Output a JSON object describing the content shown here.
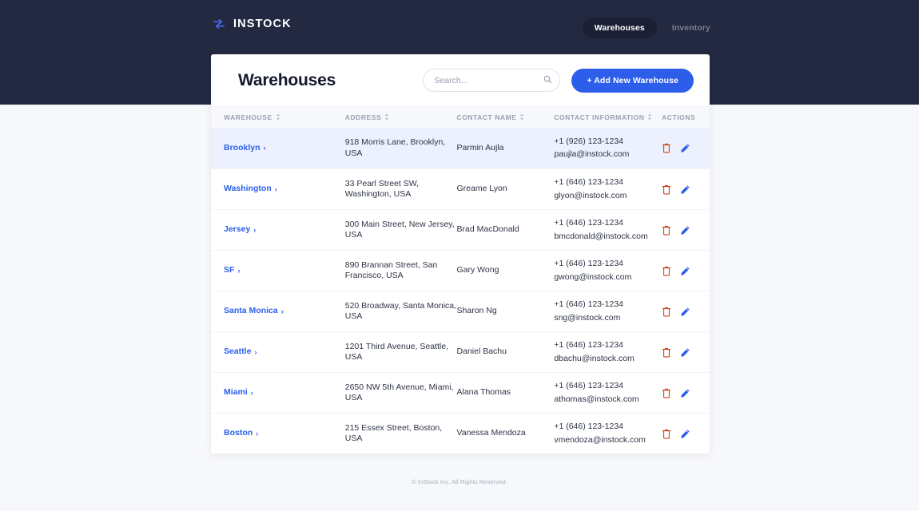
{
  "brand": {
    "name": "INSTOCK",
    "icon": "loop-arrow-icon",
    "icon_color": "#2c5eea"
  },
  "nav": {
    "tabs": [
      {
        "label": "Warehouses",
        "active": true
      },
      {
        "label": "Inventory",
        "active": false
      }
    ]
  },
  "header": {
    "title": "Warehouses",
    "search_placeholder": "Search...",
    "search_value": "",
    "search_icon": "search-icon",
    "add_button_label": "+ Add New Warehouse",
    "add_button_color": "#2c5eea"
  },
  "table": {
    "columns": [
      {
        "label": "WAREHOUSE",
        "sortable": true
      },
      {
        "label": "ADDRESS",
        "sortable": true
      },
      {
        "label": "CONTACT NAME",
        "sortable": true
      },
      {
        "label": "CONTACT INFORMATION",
        "sortable": true
      },
      {
        "label": "ACTIONS",
        "sortable": false
      }
    ],
    "action_icons": {
      "delete": "trash-icon",
      "delete_color": "#c94515",
      "edit": "pencil-icon",
      "edit_color": "#2c5eea"
    },
    "rows": [
      {
        "warehouse": "Brooklyn",
        "address": "918 Morris Lane, Brooklyn, USA",
        "contact_name": "Parmin Aujla",
        "phone": "+1 (926) 123-1234",
        "email": "paujla@instock.com",
        "highlighted": true
      },
      {
        "warehouse": "Washington",
        "address": "33 Pearl Street SW, Washington, USA",
        "contact_name": "Greame Lyon",
        "phone": "+1 (646) 123-1234",
        "email": "glyon@instock.com",
        "highlighted": false
      },
      {
        "warehouse": "Jersey",
        "address": "300 Main Street, New Jersey, USA",
        "contact_name": "Brad MacDonald",
        "phone": "+1 (646) 123-1234",
        "email": "bmcdonald@instock.com",
        "highlighted": false
      },
      {
        "warehouse": "SF",
        "address": "890 Brannan Street, San Francisco, USA",
        "contact_name": "Gary Wong",
        "phone": "+1 (646) 123-1234",
        "email": "gwong@instock.com",
        "highlighted": false
      },
      {
        "warehouse": "Santa Monica",
        "address": "520 Broadway, Santa Monica, USA",
        "contact_name": "Sharon Ng",
        "phone": "+1 (646) 123-1234",
        "email": "sng@instock.com",
        "highlighted": false
      },
      {
        "warehouse": "Seattle",
        "address": "1201 Third Avenue, Seattle, USA",
        "contact_name": "Daniel Bachu",
        "phone": "+1 (646) 123-1234",
        "email": "dbachu@instock.com",
        "highlighted": false
      },
      {
        "warehouse": "Miami",
        "address": "2650 NW 5th Avenue, Miami, USA",
        "contact_name": "Alana Thomas",
        "phone": "+1 (646) 123-1234",
        "email": "athomas@instock.com",
        "highlighted": false
      },
      {
        "warehouse": "Boston",
        "address": "215 Essex Street, Boston, USA",
        "contact_name": "Vanessa Mendoza",
        "phone": "+1 (646) 123-1234",
        "email": "vmendoza@instock.com",
        "highlighted": false
      }
    ]
  },
  "footer": {
    "text": "© InStock Inc. All Rights Reserved."
  },
  "colors": {
    "nav_background": "#232940",
    "page_background": "#f7f8fb",
    "accent": "#2c5eea",
    "row_highlight": "#edf1fd"
  }
}
